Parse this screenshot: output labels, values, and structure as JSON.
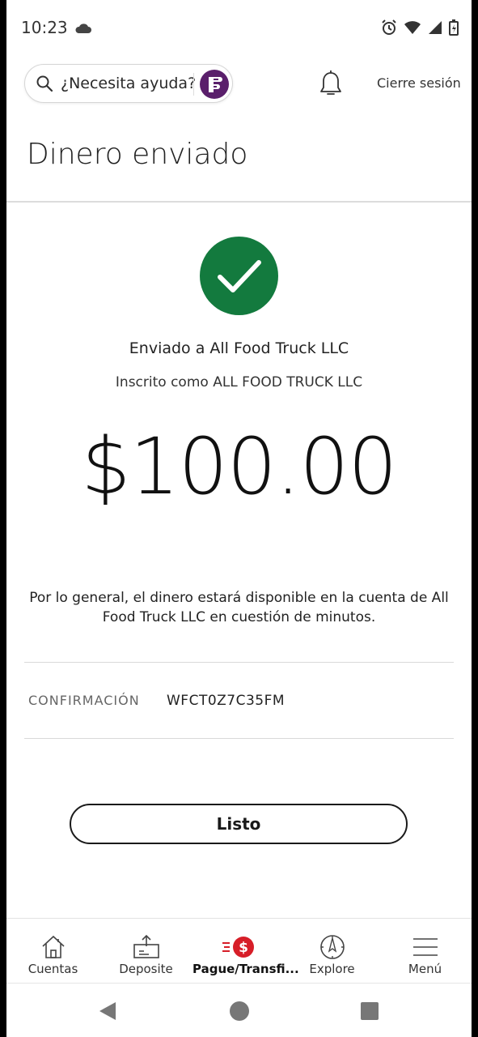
{
  "status_bar": {
    "time": "10:23"
  },
  "header": {
    "search_placeholder": "¿Necesita ayuda?",
    "signout_label": "Cierre sesión"
  },
  "page_title": "Dinero enviado",
  "confirmation": {
    "sent_to": "Enviado a All Food Truck LLC",
    "enrolled_as": "Inscrito como ALL FOOD TRUCK LLC",
    "amount": "$100.00",
    "availability_note": "Por lo general, el dinero estará disponible en la cuenta de All Food Truck LLC en cuestión de minutos.",
    "confirmation_label": "CONFIRMACIÓN",
    "confirmation_number": "WFCT0Z7C35FM"
  },
  "done_label": "Listo",
  "bottom_nav": {
    "items": [
      {
        "label": "Cuentas",
        "icon": "home-icon"
      },
      {
        "label": "Deposite",
        "icon": "deposit-icon"
      },
      {
        "label": "Pague/Transfi...",
        "icon": "pay-transfer-icon",
        "active": true
      },
      {
        "label": "Explore",
        "icon": "compass-icon"
      },
      {
        "label": "Menú",
        "icon": "menu-icon"
      }
    ]
  },
  "colors": {
    "success_green": "#137a3e",
    "brand_purple": "#5a1f6b",
    "accent_red": "#d71e28"
  }
}
